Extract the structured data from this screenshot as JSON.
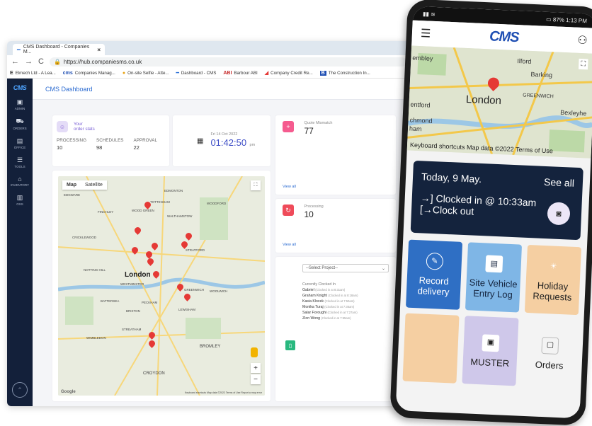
{
  "browser": {
    "tab_title": "CMS Dashboard - Companies M...",
    "url": "https://hub.companiesms.co.uk",
    "bookmarks": [
      {
        "icon": "E",
        "label": "Elmech Ltd - A Lea..."
      },
      {
        "icon": "cms",
        "label": "Companies Manag..."
      },
      {
        "icon": "selfie",
        "label": "On-site Selfie - Atte..."
      },
      {
        "icon": "dash",
        "label": "Dashboard - CMS"
      },
      {
        "icon": "ABI",
        "label": "Barbour ABI"
      },
      {
        "icon": "credit",
        "label": "Company Credit Re..."
      },
      {
        "icon": "B",
        "label": "The Construction In..."
      }
    ]
  },
  "sidebar": {
    "logo": "CMS",
    "items": [
      "ADMIN",
      "ORDERS",
      "OFFICE",
      "TOOLS",
      "INVENTORY",
      "OSS"
    ]
  },
  "dashboard": {
    "title": "CMS Dashboard",
    "stats": {
      "heading_1": "Your",
      "heading_2": "order stats",
      "processing_label": "PROCESSING",
      "processing_value": "10",
      "schedules_label": "SCHEDULES",
      "schedules_value": "98",
      "approval_label": "APPROVAL",
      "approval_value": "22"
    },
    "clock": {
      "date": "Fri 14 Oct 2022",
      "time": "01:42:50",
      "ampm": "pm"
    },
    "quote_mismatch": {
      "label": "Quote Mismatch",
      "value": "77",
      "link": "View all",
      "color": "#f55b8f"
    },
    "processing": {
      "label": "Processing",
      "value": "10",
      "link": "View all",
      "color": "#ef4b5a"
    },
    "map": {
      "tab_map": "Map",
      "tab_satellite": "Satellite",
      "google": "Google",
      "attribution": "Keyboard shortcuts   Map data ©2022   Terms of Use   Report a map error",
      "places": [
        "EDGWARE",
        "EDMONTON",
        "TOTTENHAM",
        "WOOD GREEN",
        "WOODFORD",
        "FINCHLEY",
        "WALTHAMSTOW",
        "CRICKLEWOOD",
        "STRATFORD",
        "NOTTING HILL",
        "London",
        "WESTMINSTER",
        "GREENWICH",
        "WOOLWICH",
        "BATTERSEA",
        "PECKHAM",
        "BRIXTON",
        "LEWISHAM",
        "WIMBLEDON",
        "STREATHAM",
        "Croydon",
        "Bromley"
      ]
    },
    "project": {
      "select_placeholder": "--Select Project--",
      "clocked_heading": "Currently Clocked In",
      "entries": [
        {
          "name": "Gabriel",
          "time": "(Clocked in at 8:31am)"
        },
        {
          "name": "Graham Knight",
          "time": "(Clocked in at 8:18am)"
        },
        {
          "name": "Kasia Klocek",
          "time": "(Clocked in at 7:50am)"
        },
        {
          "name": "Monika Turaj",
          "time": "(Clocked in at 7:36am)"
        },
        {
          "name": "Salar Foroughi",
          "time": "(Clocked in at 7:27am)"
        },
        {
          "name": "Zion Wong",
          "time": "(Clocked in at 7:55am)"
        }
      ]
    }
  },
  "phone": {
    "status_time": "1:13 PM",
    "battery": "87%",
    "logo": "CMS",
    "map": {
      "city": "London",
      "places": [
        "Ilford",
        "Barking",
        "GREENWICH",
        "Bexleyhe",
        "entford",
        "chmond",
        "ham",
        "embley"
      ],
      "attribution": "Keyboard shortcuts   Map data ©2022   Terms of Use"
    },
    "today": {
      "date": "Today, 9 May.",
      "see_all": "See all",
      "clocked_in": "→] Clocked in @ 10:33am",
      "clock_out": "[→Clock out"
    },
    "tiles": [
      {
        "label": "Record delivery",
        "bg": "#2f6fc4",
        "fg": "#ffffff",
        "icon": "pencil-icon"
      },
      {
        "label": "Site Vehicle Entry Log",
        "bg": "#7fb6e6",
        "fg": "#14233d",
        "icon": "barrier-icon"
      },
      {
        "label": "Holiday Requests",
        "bg": "#f5cfa2",
        "fg": "#222222",
        "icon": "sun-icon"
      },
      {
        "label": "",
        "bg": "#f5cfa2",
        "fg": "#222222",
        "icon": ""
      },
      {
        "label": "MUSTER",
        "bg": "#cfc8ea",
        "fg": "#222222",
        "icon": "badge-icon"
      },
      {
        "label": "Orders",
        "bg": "#f3f3f3",
        "fg": "#222222",
        "icon": "bag-icon"
      }
    ]
  }
}
